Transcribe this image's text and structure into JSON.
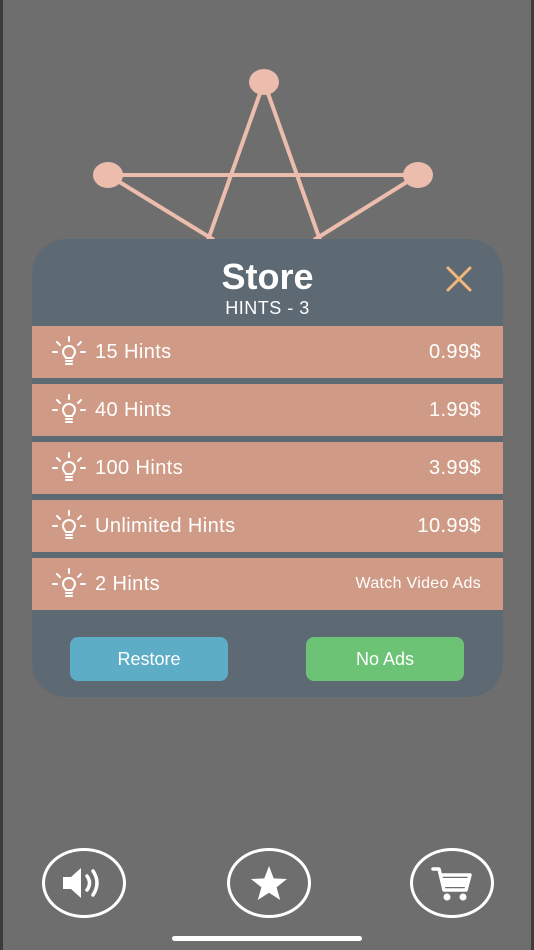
{
  "colors": {
    "background": "#6e6e6e",
    "panel": "#5d6a74",
    "item": "#cf9b86",
    "puzzle": "#ecbcac",
    "close": "#f0b67a",
    "restore": "#5eadc6",
    "no_ads": "#6cc375"
  },
  "store": {
    "title": "Store",
    "subtitle": "HINTS - 3",
    "close_icon": "close-icon",
    "items": [
      {
        "label": "15 Hints",
        "price": "0.99$",
        "icon": "lightbulb-icon"
      },
      {
        "label": "40 Hints",
        "price": "1.99$",
        "icon": "lightbulb-icon"
      },
      {
        "label": "100 Hints",
        "price": "3.99$",
        "icon": "lightbulb-icon"
      },
      {
        "label": "Unlimited Hints",
        "price": "10.99$",
        "icon": "lightbulb-icon"
      },
      {
        "label": "2 Hints",
        "price": "Watch Video Ads",
        "icon": "lightbulb-icon"
      }
    ],
    "restore_label": "Restore",
    "no_ads_label": "No Ads"
  },
  "bottom_bar": {
    "buttons": [
      {
        "icon": "speaker-icon"
      },
      {
        "icon": "star-icon"
      },
      {
        "icon": "cart-icon"
      }
    ]
  }
}
